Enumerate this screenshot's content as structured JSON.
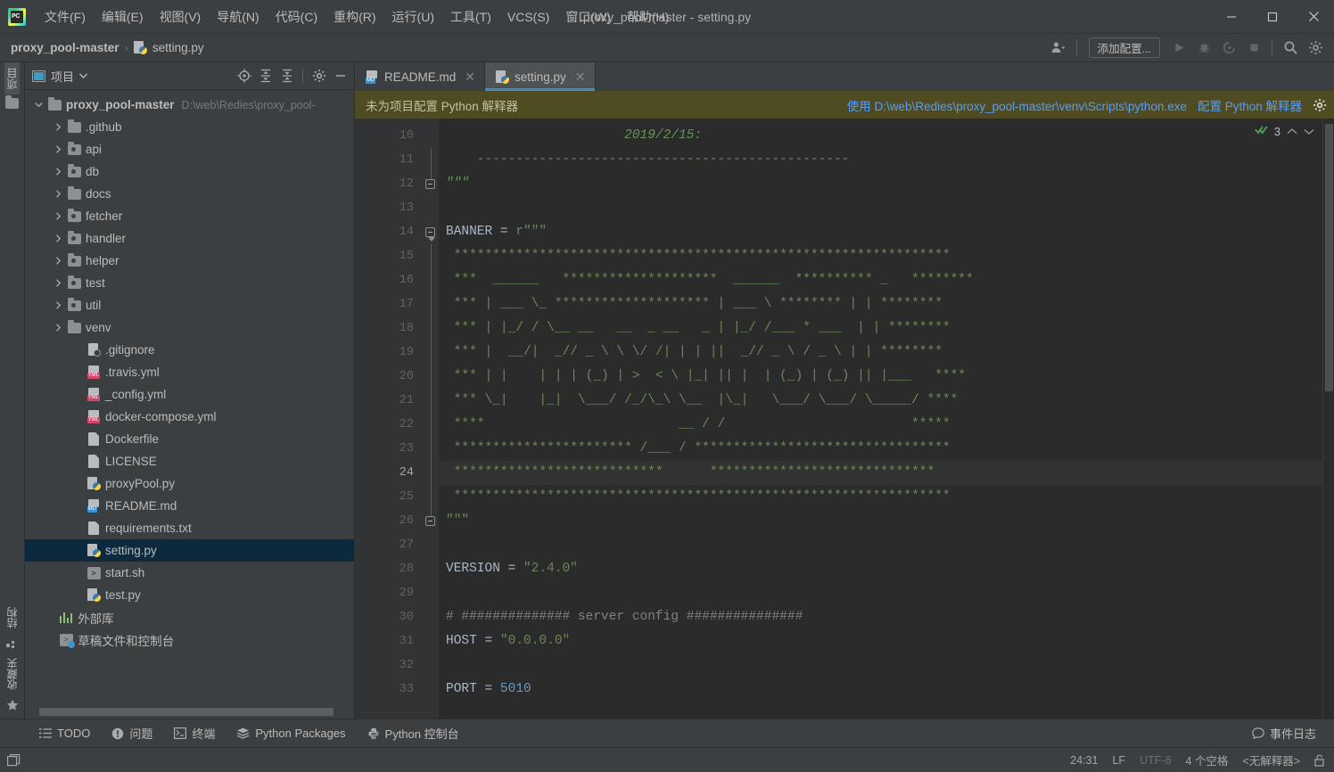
{
  "window": {
    "title": "proxy_pool-master - setting.py",
    "logo_text": "PC",
    "minimize": "minimize-icon",
    "maximize": "maximize-icon",
    "close": "close-icon"
  },
  "menu": {
    "items": [
      {
        "label": "文件(F)"
      },
      {
        "label": "编辑(E)"
      },
      {
        "label": "视图(V)"
      },
      {
        "label": "导航(N)"
      },
      {
        "label": "代码(C)"
      },
      {
        "label": "重构(R)"
      },
      {
        "label": "运行(U)"
      },
      {
        "label": "工具(T)"
      },
      {
        "label": "VCS(S)"
      },
      {
        "label": "窗口(W)"
      },
      {
        "label": "帮助(H)"
      }
    ]
  },
  "navbar": {
    "crumb_project": "proxy_pool-master",
    "crumb_sep": "›",
    "crumb_file": "setting.py",
    "add_config_label": "添加配置...",
    "icons": [
      "user-profile-icon",
      "run-icon",
      "debug-icon",
      "run-coverage-icon",
      "stop-icon",
      "search-icon",
      "settings-gear-icon"
    ]
  },
  "leftstrip": {
    "project_label": "项目",
    "structure_label": "结构",
    "favorites_label": "收藏夹"
  },
  "project_panel": {
    "title": "项目",
    "toolbar_icons": [
      "locate-target-icon",
      "expand-all-icon",
      "collapse-all-icon",
      "settings-gear-icon",
      "hide-panel-icon"
    ],
    "tree": [
      {
        "label": "proxy_pool-master",
        "path": "D:\\web\\Redies\\proxy_pool-",
        "icon": "folder",
        "indent": 0,
        "arrow": "down",
        "bold": true,
        "selected": false
      },
      {
        "label": ".github",
        "icon": "folder",
        "indent": 1,
        "arrow": "right",
        "selected": false
      },
      {
        "label": "api",
        "icon": "folder-source",
        "indent": 1,
        "arrow": "right",
        "selected": false
      },
      {
        "label": "db",
        "icon": "folder-source",
        "indent": 1,
        "arrow": "right",
        "selected": false
      },
      {
        "label": "docs",
        "icon": "folder",
        "indent": 1,
        "arrow": "right",
        "selected": false
      },
      {
        "label": "fetcher",
        "icon": "folder-source",
        "indent": 1,
        "arrow": "right",
        "selected": false
      },
      {
        "label": "handler",
        "icon": "folder-source",
        "indent": 1,
        "arrow": "right",
        "selected": false
      },
      {
        "label": "helper",
        "icon": "folder-source",
        "indent": 1,
        "arrow": "right",
        "selected": false
      },
      {
        "label": "test",
        "icon": "folder-source",
        "indent": 1,
        "arrow": "right",
        "selected": false
      },
      {
        "label": "util",
        "icon": "folder-source",
        "indent": 1,
        "arrow": "right",
        "selected": false
      },
      {
        "label": "venv",
        "icon": "folder",
        "indent": 1,
        "arrow": "right",
        "selected": false
      },
      {
        "label": ".gitignore",
        "icon": "file-git",
        "indent": 2,
        "arrow": "none",
        "selected": false
      },
      {
        "label": ".travis.yml",
        "icon": "file-yml",
        "indent": 2,
        "arrow": "none",
        "selected": false
      },
      {
        "label": "_config.yml",
        "icon": "file-yml",
        "indent": 2,
        "arrow": "none",
        "selected": false
      },
      {
        "label": "docker-compose.yml",
        "icon": "file-yml",
        "indent": 2,
        "arrow": "none",
        "selected": false
      },
      {
        "label": "Dockerfile",
        "icon": "file-doc",
        "indent": 2,
        "arrow": "none",
        "selected": false
      },
      {
        "label": "LICENSE",
        "icon": "file-doc",
        "indent": 2,
        "arrow": "none",
        "selected": false
      },
      {
        "label": "proxyPool.py",
        "icon": "file-py",
        "indent": 2,
        "arrow": "none",
        "selected": false
      },
      {
        "label": "README.md",
        "icon": "file-md",
        "indent": 2,
        "arrow": "none",
        "selected": false
      },
      {
        "label": "requirements.txt",
        "icon": "file-doc",
        "indent": 2,
        "arrow": "none",
        "selected": false
      },
      {
        "label": "setting.py",
        "icon": "file-py",
        "indent": 2,
        "arrow": "none",
        "selected": true
      },
      {
        "label": "start.sh",
        "icon": "file-sh",
        "indent": 2,
        "arrow": "none",
        "selected": false
      },
      {
        "label": "test.py",
        "icon": "file-py",
        "indent": 2,
        "arrow": "none",
        "selected": false
      },
      {
        "label": "外部库",
        "icon": "library",
        "indent": 0.6,
        "arrow": "none",
        "selected": false
      },
      {
        "label": "草稿文件和控制台",
        "icon": "scratch",
        "indent": 0.6,
        "arrow": "none",
        "selected": false
      }
    ]
  },
  "editor": {
    "tabs": [
      {
        "label": "README.md",
        "icon": "file-md",
        "active": false
      },
      {
        "label": "setting.py",
        "icon": "file-py",
        "active": true
      }
    ],
    "notification": {
      "message": "未为项目配置 Python 解释器",
      "link_use": "使用 D:\\web\\Redies\\proxy_pool-master\\venv\\Scripts\\python.exe",
      "link_configure": "配置 Python 解释器",
      "gear_icon": "settings-gear-icon"
    },
    "inspection": {
      "icon": "inspection-ok-icon",
      "count": "3",
      "up": "⌃",
      "down": "⌄"
    },
    "first_line_number": 10,
    "current_line": 24,
    "lines": [
      {
        "n": 10,
        "fold": "none",
        "segments": [
          {
            "t": "                       2019/2/15:",
            "c": "s-doc"
          }
        ]
      },
      {
        "n": 11,
        "fold": "none",
        "segments": [
          {
            "t": "    ------------------------------------------------",
            "c": "s-doc"
          }
        ]
      },
      {
        "n": 12,
        "fold": "end",
        "segments": [
          {
            "t": "\"\"\"",
            "c": "s-doc"
          }
        ]
      },
      {
        "n": 13,
        "fold": "none",
        "segments": [
          {
            "t": "",
            "c": ""
          }
        ]
      },
      {
        "n": 14,
        "fold": "start",
        "segments": [
          {
            "t": "BANNER = ",
            "c": "s-var"
          },
          {
            "t": "r\"\"\"",
            "c": "s-str"
          }
        ]
      },
      {
        "n": 15,
        "fold": "bar",
        "segments": [
          {
            "t": " ****************************************************************",
            "c": "s-str"
          }
        ]
      },
      {
        "n": 16,
        "fold": "bar",
        "segments": [
          {
            "t": " ***  ______   ********************  ______  ********** _   ********",
            "c": "s-str"
          }
        ]
      },
      {
        "n": 17,
        "fold": "bar",
        "segments": [
          {
            "t": " *** | ___ \\_ ******************** | ___ \\ ******** | | ********",
            "c": "s-str"
          }
        ]
      },
      {
        "n": 18,
        "fold": "bar",
        "segments": [
          {
            "t": " *** | |_/ / \\__ __   __  _ __   _ | |_/ /___ * ___  | | ********",
            "c": "s-str"
          }
        ]
      },
      {
        "n": 19,
        "fold": "bar",
        "segments": [
          {
            "t": " *** |  __/|  _// _ \\ \\ \\/ /| | | ||  _// _ \\ / _ \\ | | ********",
            "c": "s-str"
          }
        ]
      },
      {
        "n": 20,
        "fold": "bar",
        "segments": [
          {
            "t": " *** | |    | | | (_) | >  < \\ |_| || |  | (_) | (_) || |___   ****",
            "c": "s-str"
          }
        ]
      },
      {
        "n": 21,
        "fold": "bar",
        "segments": [
          {
            "t": " *** \\_|    |_|  \\___/ /_/\\_\\ \\__  |\\_|   \\___/ \\___/ \\_____/ ****",
            "c": "s-str"
          }
        ]
      },
      {
        "n": 22,
        "fold": "bar",
        "segments": [
          {
            "t": " ****                         __ / /                        *****",
            "c": "s-str"
          }
        ]
      },
      {
        "n": 23,
        "fold": "bar",
        "bulb": true,
        "segments": [
          {
            "t": " *********************** /___ / *********************************",
            "c": "s-str"
          }
        ]
      },
      {
        "n": 24,
        "fold": "bar",
        "segments": [
          {
            "t": " ***************************      *****************************",
            "c": "s-str"
          }
        ]
      },
      {
        "n": 25,
        "fold": "bar",
        "segments": [
          {
            "t": " ****************************************************************",
            "c": "s-str"
          }
        ]
      },
      {
        "n": 26,
        "fold": "end",
        "segments": [
          {
            "t": "\"\"\"",
            "c": "s-str"
          }
        ]
      },
      {
        "n": 27,
        "fold": "none",
        "segments": [
          {
            "t": "",
            "c": ""
          }
        ]
      },
      {
        "n": 28,
        "fold": "none",
        "segments": [
          {
            "t": "VERSION = ",
            "c": "s-var"
          },
          {
            "t": "\"2.4.0\"",
            "c": "s-str"
          }
        ]
      },
      {
        "n": 29,
        "fold": "none",
        "segments": [
          {
            "t": "",
            "c": ""
          }
        ]
      },
      {
        "n": 30,
        "fold": "none",
        "segments": [
          {
            "t": "# ############## server config ###############",
            "c": "s-cmt"
          }
        ]
      },
      {
        "n": 31,
        "fold": "none",
        "segments": [
          {
            "t": "HOST = ",
            "c": "s-var"
          },
          {
            "t": "\"0.0.0.0\"",
            "c": "s-str"
          }
        ]
      },
      {
        "n": 32,
        "fold": "none",
        "segments": [
          {
            "t": "",
            "c": ""
          }
        ]
      },
      {
        "n": 33,
        "fold": "none",
        "segments": [
          {
            "t": "PORT = ",
            "c": "s-var"
          },
          {
            "t": "5010",
            "c": "s-num"
          }
        ]
      }
    ]
  },
  "toolwindows": {
    "items": [
      {
        "label": "TODO",
        "icon": "todo-list-icon"
      },
      {
        "label": "问题",
        "icon": "problems-warning-icon"
      },
      {
        "label": "终端",
        "icon": "terminal-icon"
      },
      {
        "label": "Python Packages",
        "icon": "packages-layers-icon"
      },
      {
        "label": "Python 控制台",
        "icon": "python-console-icon"
      }
    ],
    "event_log": {
      "label": "事件日志",
      "icon": "event-log-icon"
    }
  },
  "statusbar": {
    "left_icon": "toggle-layout-icon",
    "caret": "24:31",
    "line_sep": "LF",
    "encoding": "UTF-8",
    "indent": "4 个空格",
    "interpreter": "<无解释器>",
    "lock_icon": "unlocked-icon"
  },
  "colors": {
    "chrome": "#3C3F41",
    "editor_bg": "#2B2B2B",
    "gutter_bg": "#313335",
    "notification_bg": "#4F4B23",
    "accent_blue": "#4A88C7",
    "link_blue": "#589DF6",
    "selection_blue": "#0D293E",
    "string_green": "#6A8759",
    "comment_gray": "#808080",
    "number_blue": "#6897BB"
  }
}
